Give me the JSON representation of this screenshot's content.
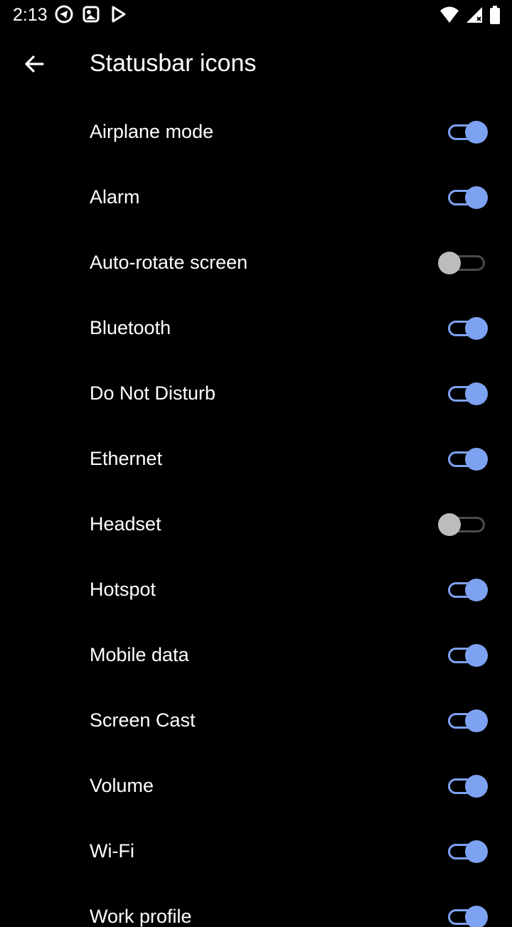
{
  "status_bar": {
    "time": "2:13",
    "left_icons": [
      "telegram-icon",
      "photos-icon",
      "play-store-icon"
    ],
    "right_icons": [
      "wifi-icon",
      "mobile-signal-icon",
      "battery-icon"
    ]
  },
  "header": {
    "title": "Statusbar icons",
    "back_icon": "arrow-back-icon"
  },
  "accent_color": "#7ea2f2",
  "settings": [
    {
      "label": "Airplane mode",
      "on": true
    },
    {
      "label": "Alarm",
      "on": true
    },
    {
      "label": "Auto-rotate screen",
      "on": false
    },
    {
      "label": "Bluetooth",
      "on": true
    },
    {
      "label": "Do Not Disturb",
      "on": true
    },
    {
      "label": "Ethernet",
      "on": true
    },
    {
      "label": "Headset",
      "on": false
    },
    {
      "label": "Hotspot",
      "on": true
    },
    {
      "label": "Mobile data",
      "on": true
    },
    {
      "label": "Screen Cast",
      "on": true
    },
    {
      "label": "Volume",
      "on": true
    },
    {
      "label": "Wi-Fi",
      "on": true
    },
    {
      "label": "Work profile",
      "on": true
    }
  ]
}
